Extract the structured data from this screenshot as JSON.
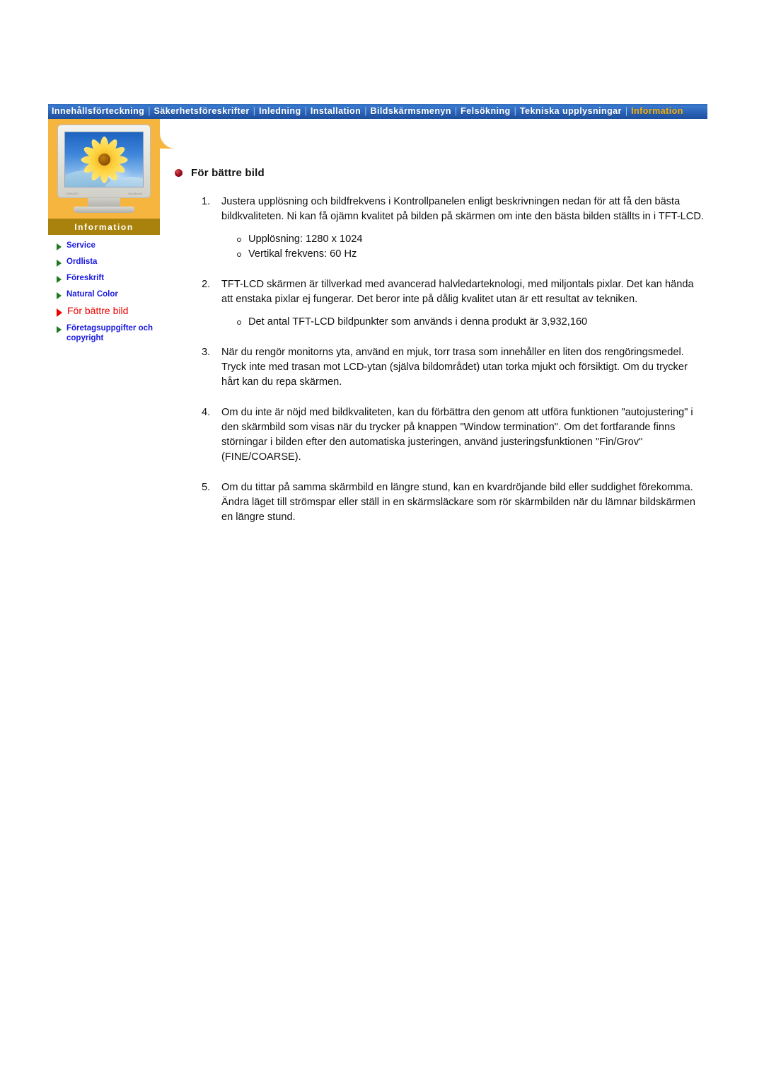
{
  "topnav": {
    "separator": "|",
    "items": [
      {
        "label": "Innehållsförteckning",
        "active": false
      },
      {
        "label": "Säkerhetsföreskrifter",
        "active": false
      },
      {
        "label": "Inledning",
        "active": false
      },
      {
        "label": "Installation",
        "active": false
      },
      {
        "label": "Bildskärmsmenyn",
        "active": false
      },
      {
        "label": "Felsökning",
        "active": false
      },
      {
        "label": "Tekniska upplysningar",
        "active": false
      },
      {
        "label": "Information",
        "active": true
      }
    ],
    "colors": {
      "bar_background": "#2a63b8",
      "item_text": "#ffffff",
      "active_item_text": "#ffb200",
      "separator": "#9fc2e8"
    }
  },
  "sidebar": {
    "panel_color": "#f6b53f",
    "title": "Information",
    "title_bar_color": "#a8820c",
    "monitor_image": {
      "alt": "LCD monitor displaying a sunflower on a blue sky background",
      "brand_left": "SAMSUNG",
      "brand_right": "SyncMaster"
    },
    "items": [
      {
        "label": "Service",
        "active": false
      },
      {
        "label": "Ordlista",
        "active": false
      },
      {
        "label": "Föreskrift",
        "active": false
      },
      {
        "label": "Natural Color",
        "active": false
      },
      {
        "label": "För bättre bild",
        "active": true
      },
      {
        "label": "Företagsuppgifter och copyright",
        "active": false
      }
    ],
    "colors": {
      "link_text": "#1a1ae0",
      "active_link_text": "#ee0000",
      "arrow": "#1e7a1e",
      "active_arrow": "#ee0000"
    }
  },
  "content": {
    "heading": "För bättre bild",
    "heading_bullet_color": "#a31020",
    "steps": [
      {
        "number": "1.",
        "text": "Justera upplösning och bildfrekvens i Kontrollpanelen enligt beskrivningen nedan för att få den bästa bildkvaliteten. Ni kan få ojämn kvalitet på bilden på skärmen om inte den bästa bilden ställts in i TFT-LCD.",
        "subs": [
          "Upplösning: 1280 x 1024",
          "Vertikal frekvens: 60 Hz"
        ]
      },
      {
        "number": "2.",
        "text": "TFT-LCD skärmen är tillverkad med avancerad halvledarteknologi, med miljontals pixlar. Det kan hända att enstaka pixlar ej fungerar. Det beror inte på dålig kvalitet utan är ett resultat av tekniken.",
        "subs": [
          "Det antal TFT-LCD bildpunkter som används i denna produkt är 3,932,160"
        ]
      },
      {
        "number": "3.",
        "text": "När du rengör monitorns yta, använd en mjuk, torr trasa som innehåller en liten dos rengöringsmedel. Tryck inte med trasan mot LCD-ytan (själva bildområdet) utan torka mjukt och försiktigt. Om du trycker hårt kan du repa skärmen.",
        "subs": []
      },
      {
        "number": "4.",
        "text": "Om du inte är nöjd med bildkvaliteten, kan du förbättra den genom att utföra funktionen \"autojustering\" i den skärmbild som visas när du trycker på knappen \"Window termination\". Om det fortfarande finns störningar i bilden efter den automatiska justeringen, använd justeringsfunktionen \"Fin/Grov\" (FINE/COARSE).",
        "subs": []
      },
      {
        "number": "5.",
        "text": "Om du tittar på samma skärmbild en längre stund, kan en kvardröjande bild eller suddighet förekomma.\nÄndra läget till strömspar eller ställ in en skärmsläckare som rör skärmbilden när du lämnar bildskärmen en längre stund.",
        "subs": []
      }
    ]
  }
}
